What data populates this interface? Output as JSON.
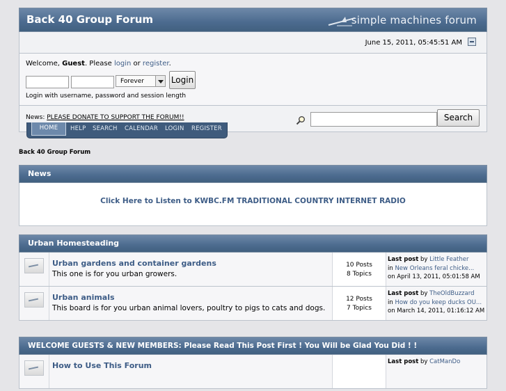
{
  "header": {
    "forum_title": "Back 40 Group Forum",
    "logo_text": "simple machines forum"
  },
  "datebar": {
    "date": "June 15, 2011, 05:45:51 AM"
  },
  "userbox": {
    "welcome_prefix": "Welcome, ",
    "guest": "Guest",
    "please": ". Please ",
    "login_link": "login",
    "or": " or ",
    "register_link": "register",
    "period": ".",
    "username_value": "",
    "password_value": "",
    "duration_selected": "Forever",
    "login_button": "Login",
    "hint": "Login with username, password and session length"
  },
  "newsbar": {
    "label": "News: ",
    "link": "PLEASE DONATE TO SUPPORT THE FORUM!!",
    "search_value": "",
    "search_button": "Search"
  },
  "tabs": [
    {
      "label": "HOME",
      "active": true
    },
    {
      "label": "HELP"
    },
    {
      "label": "SEARCH"
    },
    {
      "label": "CALENDAR"
    },
    {
      "label": "LOGIN"
    },
    {
      "label": "REGISTER"
    }
  ],
  "breadcrumb": "Back 40 Group Forum",
  "news_box": {
    "title": "News",
    "link": "Click Here to Listen to KWBC.FM TRADITIONAL COUNTRY INTERNET RADIO"
  },
  "categories": [
    {
      "title": "Urban Homesteading",
      "boards": [
        {
          "name": "Urban gardens and container gardens",
          "desc": "This one is for you urban growers.",
          "posts": "10 Posts",
          "topics": "8 Topics",
          "lp_label": "Last post",
          "lp_by": " by ",
          "lp_user": "Little Feather",
          "lp_in": "in ",
          "lp_topic": "New Orleans feral chicke...",
          "lp_on": "on April 13, 2011, 05:01:58 AM"
        },
        {
          "name": "Urban animals",
          "desc": "This board is for you urban animal lovers, poultry to pigs to cats and dogs.",
          "posts": "12 Posts",
          "topics": "7 Topics",
          "lp_label": "Last post",
          "lp_by": " by ",
          "lp_user": "TheOldBuzzard",
          "lp_in": "in ",
          "lp_topic": "How do you keep ducks OU...",
          "lp_on": "on March 14, 2011, 01:16:12 AM"
        }
      ]
    },
    {
      "title": "WELCOME GUESTS & NEW MEMBERS: Please Read This Post First ! You Will be Glad You Did ! !",
      "boards": [
        {
          "name": "How to Use This Forum",
          "lp_label": "Last post",
          "lp_by": " by ",
          "lp_user": "CatManDo"
        }
      ]
    }
  ]
}
